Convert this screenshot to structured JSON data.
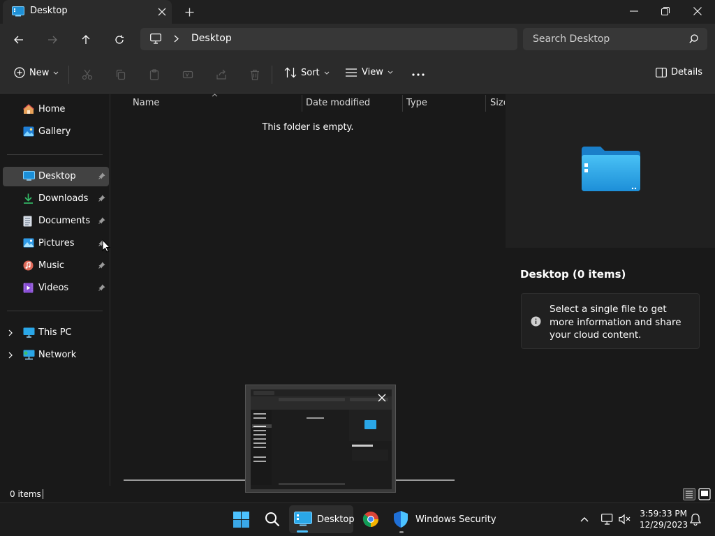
{
  "window": {
    "tab_title": "Desktop",
    "controls": [
      "minimize",
      "maximize",
      "close"
    ]
  },
  "address": {
    "location": "Desktop",
    "search_placeholder": "Search Desktop"
  },
  "commandbar": {
    "new_label": "New",
    "sort_label": "Sort",
    "view_label": "View",
    "details_label": "Details",
    "icons": [
      "cut-icon",
      "copy-icon",
      "paste-icon",
      "rename-icon",
      "share-icon",
      "delete-icon",
      "more-icon"
    ]
  },
  "navigation": {
    "top_items": [
      {
        "label": "Home",
        "icon": "home-icon"
      },
      {
        "label": "Gallery",
        "icon": "gallery-icon"
      }
    ],
    "quick_access": [
      {
        "label": "Desktop",
        "icon": "desktop-icon",
        "selected": true
      },
      {
        "label": "Downloads",
        "icon": "downloads-icon"
      },
      {
        "label": "Documents",
        "icon": "documents-icon"
      },
      {
        "label": "Pictures",
        "icon": "pictures-icon"
      },
      {
        "label": "Music",
        "icon": "music-icon"
      },
      {
        "label": "Videos",
        "icon": "videos-icon"
      }
    ],
    "drives": [
      {
        "label": "This PC",
        "icon": "pc-icon"
      },
      {
        "label": "Network",
        "icon": "network-icon"
      }
    ]
  },
  "filelist": {
    "columns": [
      "Name",
      "Date modified",
      "Type",
      "Size"
    ],
    "empty_message": "This folder is empty."
  },
  "details": {
    "title": "Desktop (0 items)",
    "info_text": "Select a single file to get more information and share your cloud content."
  },
  "status": {
    "item_count": "0 items"
  },
  "taskbar": {
    "explorer_label": "Desktop",
    "security_label": "Windows Security",
    "time": "3:59:33 PM",
    "date": "12/29/2023"
  },
  "colors": {
    "accent": "#4cc2ff",
    "folder": "#2aa7e8",
    "background": "#191919"
  }
}
